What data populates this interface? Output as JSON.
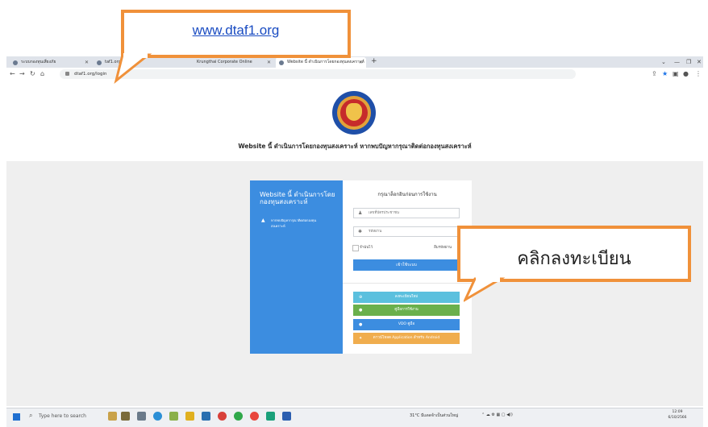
{
  "callouts": {
    "url": "www.dtaf1.org",
    "register": "คลิกลงทะเบียน"
  },
  "browser": {
    "tabs": [
      {
        "label": "ระบบกองทุนเสี่ยงภัย"
      },
      {
        "label": "taf1.org"
      },
      {
        "label": "Krungthai Corporate Online"
      },
      {
        "label": "Website นี้ ดำเนินการโดยกองทุนสงเคราะห์"
      }
    ],
    "new_tab": "+",
    "url": "dtaf1.org/login"
  },
  "page": {
    "title": "Website นี้ ดำเนินการโดยกองทุนสงเคราะห์ หากพบปัญหากรุณาติดต่อกองทุนสงเคราะห์",
    "left_panel": {
      "heading": "Website นี้ ดำเนินการโดยกองทุนสงเคราะห์",
      "note": "หากพบปัญหากรุณาติดต่อกองทุนสงเคราะห์"
    },
    "form": {
      "title": "กรุณาล็อกอินก่อนการใช้งาน",
      "id_placeholder": "เลขที่บัตรประชาชน",
      "password_placeholder": "รหัสผ่าน",
      "remember": "จำฉันไว้",
      "forgot": "ลืมรหัสผ่าน",
      "login_button": "เข้าใช้ระบบ"
    },
    "actions": [
      {
        "label": "ลงทะเบียนใหม่",
        "color": "#5bc0de"
      },
      {
        "label": "คู่มือการใช้งาน",
        "color": "#6ab04c"
      },
      {
        "label": "VDO คู่มือ",
        "color": "#3c8de0"
      },
      {
        "label": "ดาวน์โหลด Application สำหรับ Android",
        "color": "#f0ad4e"
      }
    ]
  },
  "taskbar": {
    "search_placeholder": "Type here to search",
    "weather": "31°C มีแดดจ้าเป็นส่วนใหญ่",
    "time": "12:09",
    "date": "6/10/2566"
  }
}
